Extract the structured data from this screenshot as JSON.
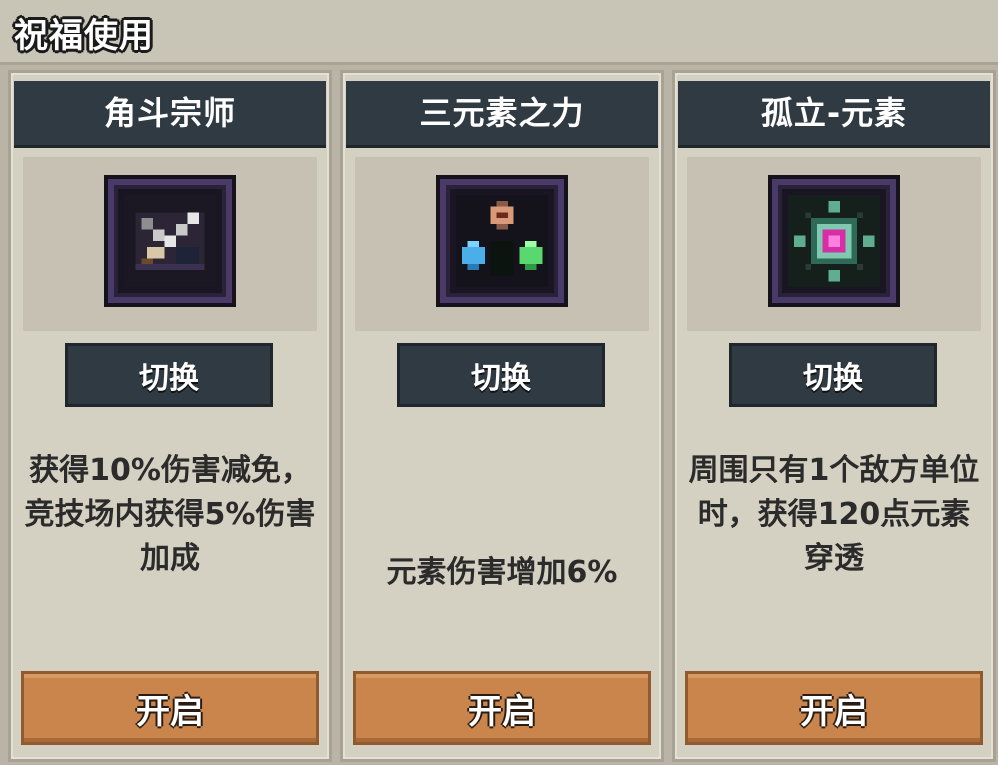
{
  "header": {
    "title": "祝福使用"
  },
  "cards": [
    {
      "title": "角斗宗师",
      "icon": "crossed-swords-icon",
      "switch_label": "切换",
      "description": "获得10%伤害减免，竞技场内获得5%伤害加成",
      "open_label": "开启"
    },
    {
      "title": "三元素之力",
      "icon": "three-elements-gems-icon",
      "switch_label": "切换",
      "description": "元素伤害增加6%",
      "open_label": "开启"
    },
    {
      "title": "孤立-元素",
      "icon": "isolated-element-crystal-icon",
      "switch_label": "切换",
      "description": "周围只有1个敌方单位时，获得120点元素穿透",
      "open_label": "开启"
    }
  ],
  "colors": {
    "panel_bg": "#d4d0c2",
    "title_bar": "#2f3a43",
    "open_button": "#c9854c",
    "icon_frame": "#4a3a6a"
  }
}
